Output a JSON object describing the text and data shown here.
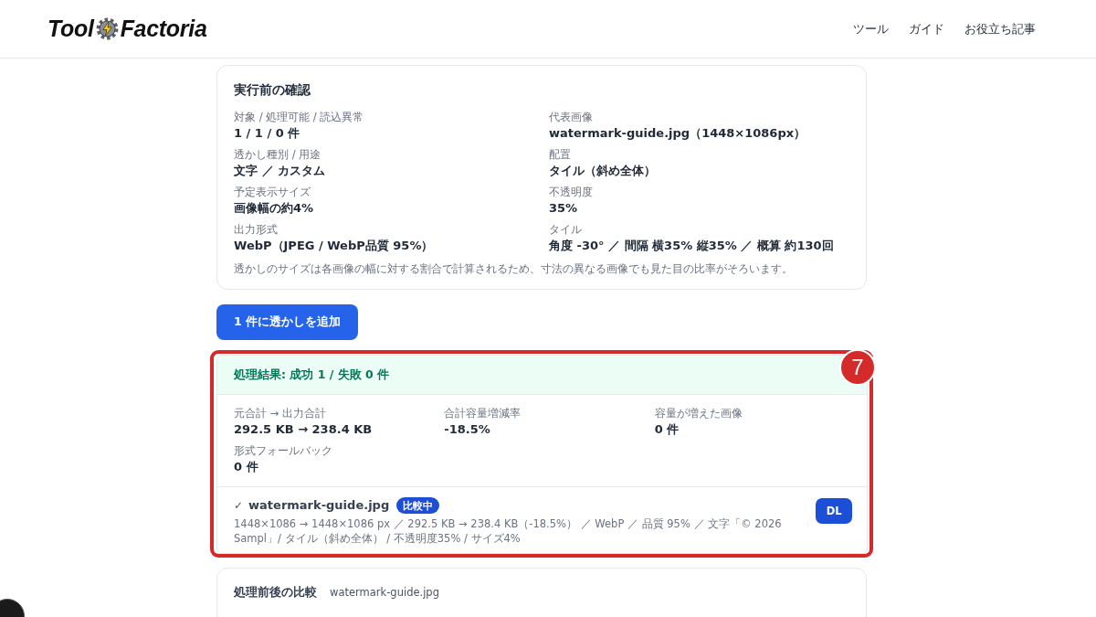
{
  "header": {
    "logo": [
      "Tool",
      "Factoria"
    ],
    "nav": [
      "ツール",
      "ガイド",
      "お役立ち記事"
    ]
  },
  "confirmation": {
    "title": "実行前の確認",
    "fields": [
      {
        "label": "対象 / 処理可能 / 読込異常",
        "value": "1 / 1 / 0 件"
      },
      {
        "label": "代表画像",
        "value": "watermark-guide.jpg（1448×1086px）"
      },
      {
        "label": "透かし種別 / 用途",
        "value": "文字 ／ カスタム"
      },
      {
        "label": "配置",
        "value": "タイル（斜め全体）"
      },
      {
        "label": "予定表示サイズ",
        "value": "画像幅の約4%"
      },
      {
        "label": "不透明度",
        "value": "35%"
      },
      {
        "label": "出力形式",
        "value": "WebP（JPEG / WebP品質 95%）"
      },
      {
        "label": "タイル",
        "value": "角度 -30° ／ 間隔 横35% 縦35% ／ 概算 約130回"
      }
    ],
    "note": "透かしのサイズは各画像の幅に対する割合で計算されるため、寸法の異なる画像でも見た目の比率がそろいます。"
  },
  "submit_button": "1 件に透かしを追加",
  "results": {
    "annotation": "7",
    "summary": {
      "kind": "success",
      "text": "処理結果: 成功 1 / 失敗 0 件"
    },
    "stats": [
      {
        "label": "元合計 → 出力合計",
        "value": "292.5 KB → 238.4 KB"
      },
      {
        "label": "合計容量増減率",
        "value": "-18.5%"
      },
      {
        "label": "容量が増えた画像",
        "value": "0 件"
      },
      {
        "label": "形式フォールバック",
        "value": "0 件"
      }
    ],
    "files": [
      {
        "mark": "✓",
        "name": "watermark-guide.jpg",
        "badge": "比較中",
        "details": "1448×1086 → 1448×1086 px ／ 292.5 KB → 238.4 KB（-18.5%） ／ WebP ／ 品質 95% ／ 文字「© 2026 Sampl」/ タイル（斜め全体） / 不透明度35% / サイズ4%",
        "action": "DL"
      }
    ]
  },
  "comparison": {
    "title": "処理前後の比較",
    "file": "watermark-guide.jpg"
  }
}
